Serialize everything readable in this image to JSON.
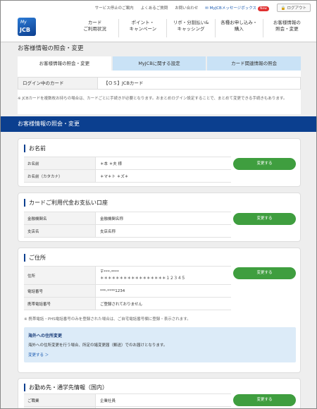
{
  "utility": {
    "links": [
      "サービス停止のご案内",
      "よくあるご質問",
      "お問い合わせ"
    ],
    "message_box": "MyJCBメッセージボックス",
    "badge": "New",
    "logout": "ログアウト"
  },
  "logo": {
    "my": "My",
    "jcb": "JCB"
  },
  "gnav": [
    "カード\nご利用状況",
    "ポイント・\nキャンペーン",
    "リボ・分割払い&\nキャッシング",
    "各種お申し込み・\n購入",
    "お客様情報の\n照会・変更"
  ],
  "page_title": "お客様情報の照会・変更",
  "tabs": [
    "お客様情報の照会・変更",
    "MyJCBに関する設定",
    "カード関連情報の照会"
  ],
  "login_card": {
    "label": "ログイン中のカード",
    "value": "【ＯＳ】JCBカード"
  },
  "note": "※ JCBカードを複数枚お持ちの場合は、カードごとに手続きが必要となります。おまとめログイン設定することで、まとめて変更できる手続きもあります。",
  "band_title": "お客様情報の照会・変更",
  "change_label": "変更する",
  "name_section": {
    "title": "お名前",
    "rows": [
      {
        "label": "お名前",
        "value": "＊本 ＊夫 様"
      },
      {
        "label": "お名前（カタカナ）",
        "value": "＊マ＊ト ＊ズ＊"
      }
    ]
  },
  "bank_section": {
    "title": "カードご利用代金お支払い口座",
    "rows": [
      {
        "label": "金融機関名",
        "value": "金融機関名称"
      },
      {
        "label": "支店名",
        "value": "支店名称"
      }
    ]
  },
  "address_section": {
    "title": "ご住所",
    "address_label": "住所",
    "address_line1": "〒***-****",
    "address_line2": "＊＊＊＊＊＊＊＊＊＊＊＊＊＊＊＊＊１２３４５",
    "rows": [
      {
        "label": "電話番号",
        "value": "***-****1234"
      },
      {
        "label": "携帯電話番号",
        "value": "ご登録されておりません"
      }
    ],
    "note": "※ 携帯電話・PHS電話番号のみを登録された場合は、ご自宅電話番号欄に登録・表示されます。",
    "overseas_title": "海外への住所変更",
    "overseas_body": "海外への住所変更を行う場合、所定の諸変更届（郵送）でのお届けとなります。",
    "overseas_link": "変更する ＞"
  },
  "work_section": {
    "title": "お勤め先・通学先情報（国内）",
    "rows": [
      {
        "label": "ご職業",
        "value": "企業社員"
      },
      {
        "label": "",
        "value": ""
      }
    ]
  }
}
